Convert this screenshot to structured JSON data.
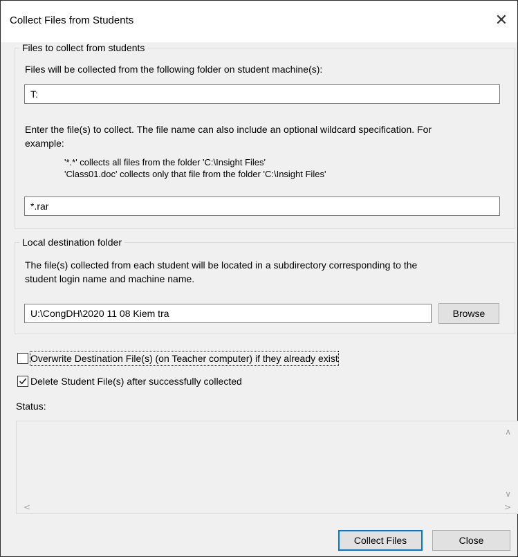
{
  "window": {
    "title": "Collect Files from Students",
    "close_icon": "close-icon"
  },
  "files_group": {
    "legend": "Files to collect from students",
    "folder_instruction": "Files will be collected from the following folder on student machine(s):",
    "folder_value": "T:",
    "files_instruction_line1": "Enter the file(s) to collect. The file name can also include an optional wildcard specification. For",
    "files_instruction_line2": "example:",
    "example1": "'*.*' collects all files from the folder 'C:\\Insight Files'",
    "example2": "'Class01.doc' collects only that file from the folder 'C:\\Insight Files'",
    "files_value": "*.rar"
  },
  "destination_group": {
    "legend": "Local destination folder",
    "description_line1": "The file(s) collected from each student will be located in a subdirectory corresponding to the",
    "description_line2": "student login name and machine name.",
    "folder_value": "U:\\CongDH\\2020 11 08 Kiem tra",
    "browse_label": "Browse"
  },
  "options": {
    "overwrite_label": "Overwrite Destination File(s) (on Teacher computer) if they already exist",
    "overwrite_checked": false,
    "delete_label": "Delete Student File(s) after successfully collected",
    "delete_checked": true
  },
  "status": {
    "label": "Status:",
    "text": ""
  },
  "buttons": {
    "collect_label": "Collect Files",
    "close_label": "Close"
  },
  "colors": {
    "dialog_bg": "#f0f0f0",
    "default_button_border": "#0078d7"
  }
}
